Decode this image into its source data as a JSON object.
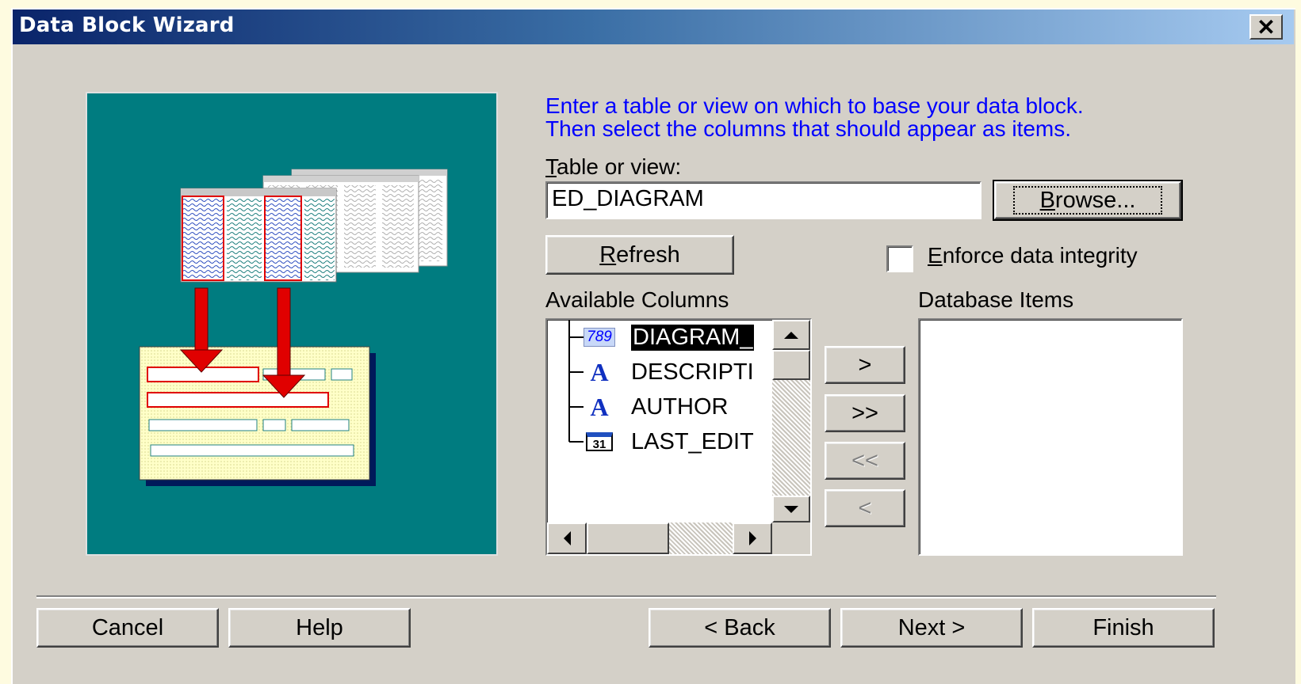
{
  "window": {
    "title": "Data Block Wizard"
  },
  "instructions": {
    "line1": "Enter a table or view on which to base your data block.",
    "line2": "Then select the columns that should appear as items."
  },
  "table_view": {
    "label_mnemonic": "T",
    "label_rest": "able or view:",
    "value": "ED_DIAGRAM"
  },
  "buttons": {
    "browse_mnemonic": "B",
    "browse_rest": "rowse...",
    "refresh_mnemonic": "R",
    "refresh_rest": "efresh",
    "add_one": ">",
    "add_all": ">>",
    "remove_all": "<<",
    "remove_one": "<",
    "cancel": "Cancel",
    "help": "Help",
    "back": "< Back",
    "next": "Next >",
    "finish": "Finish"
  },
  "enforce": {
    "mnemonic": "E",
    "rest": "nforce data integrity",
    "checked": false
  },
  "available_columns": {
    "header": "Available Columns",
    "items": [
      {
        "label": "DIAGRAM_",
        "icon": "number-icon",
        "icon_text": "789",
        "selected": true
      },
      {
        "label": "DESCRIPTI",
        "icon": "text-icon",
        "icon_text": "A",
        "selected": false
      },
      {
        "label": "AUTHOR",
        "icon": "text-icon",
        "icon_text": "A",
        "selected": false
      },
      {
        "label": "LAST_EDIT",
        "icon": "date-icon",
        "icon_text": "31",
        "selected": false
      }
    ]
  },
  "database_items": {
    "header": "Database Items",
    "items": []
  }
}
